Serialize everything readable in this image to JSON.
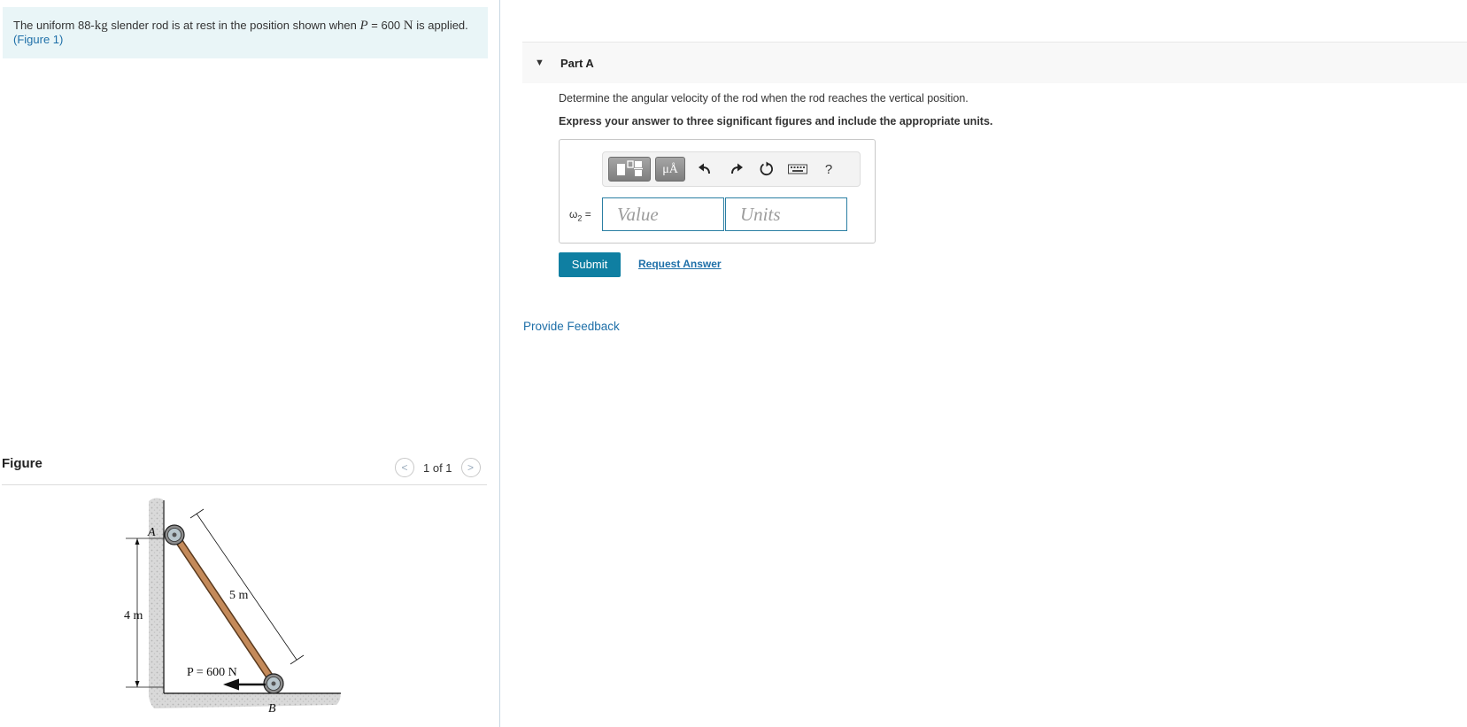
{
  "problem": {
    "text_before_mass": "The uniform 88-",
    "mass_unit": "kg",
    "text_after_mass": " slender rod is at rest in the position shown when ",
    "force_symbol": "P",
    "force_equals": " = 600 ",
    "force_unit": "N",
    "text_end": " is applied.",
    "figure_link": "(Figure 1)"
  },
  "figure": {
    "heading": "Figure",
    "pager": {
      "prev": "<",
      "count": "1 of 1",
      "next": ">"
    },
    "labels": {
      "point_a": "A",
      "point_b": "B",
      "length": "5 m",
      "height": "4 m",
      "force": "P = 600 N"
    }
  },
  "part": {
    "title": "Part A",
    "question": "Determine the angular velocity of the rod when the rod reaches the vertical position.",
    "instruction": "Express your answer to three significant figures and include the appropriate units."
  },
  "answer": {
    "variable_symbol": "ω",
    "variable_subscript": "2",
    "equals": " =",
    "value_placeholder": "Value",
    "units_placeholder": "Units",
    "units_button": "μÅ",
    "help_button": "?"
  },
  "actions": {
    "submit": "Submit",
    "request_answer": "Request Answer",
    "provide_feedback": "Provide Feedback"
  },
  "colors": {
    "problem_bg": "#e9f5f7",
    "accent": "#0f7fa2",
    "link": "#1e6fa8",
    "input_border": "#2b7fa3"
  },
  "icons": {
    "template": "template-icon",
    "undo": "undo-icon",
    "redo": "redo-icon",
    "reset": "reset-icon",
    "keyboard": "keyboard-icon"
  }
}
